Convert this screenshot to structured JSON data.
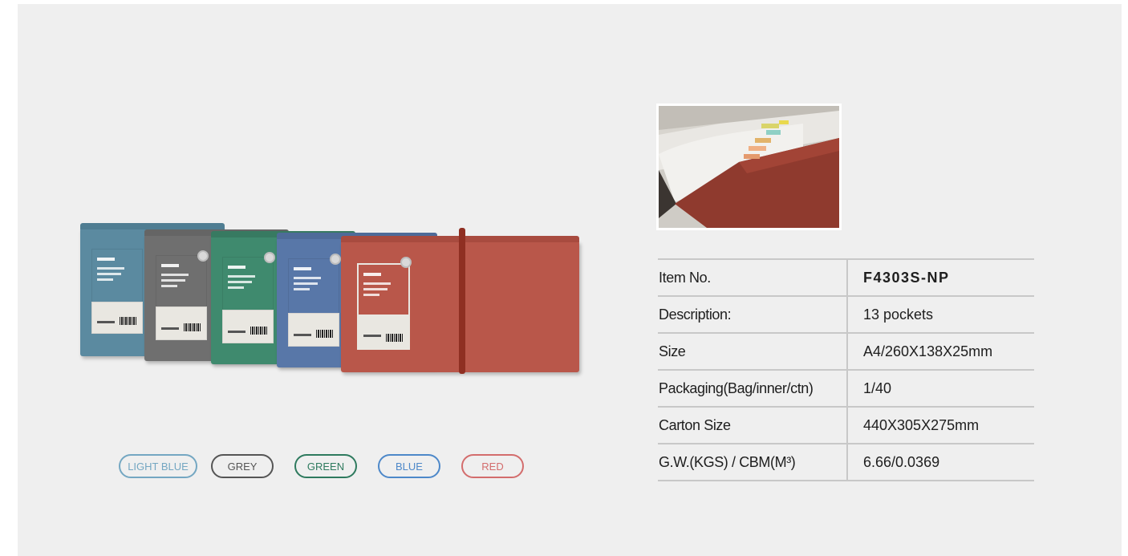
{
  "colors": {
    "panel": "#efefef",
    "light_blue": "#5b8aa0",
    "grey": "#6f6f6f",
    "green": "#3f8a6e",
    "blue": "#5877a8",
    "red": "#b9574a"
  },
  "product": {
    "card_text": {
      "title": "CHECK",
      "line1": "13POCKETS",
      "line2": "EXPANDING",
      "line3": "FILE"
    }
  },
  "color_options": [
    {
      "label": "LIGHT BLUE",
      "color": "#74a7c2"
    },
    {
      "label": "GREY",
      "color": "#555555"
    },
    {
      "label": "GREEN",
      "color": "#2e7a5e"
    },
    {
      "label": "BLUE",
      "color": "#4d88c9"
    },
    {
      "label": "RED",
      "color": "#d36d6d"
    }
  ],
  "specs": [
    {
      "key": "Item No.",
      "value": "F4303S-NP"
    },
    {
      "key": "Description:",
      "value": "13 pockets"
    },
    {
      "key": "Size",
      "value": "A4/260X138X25mm"
    },
    {
      "key": "Packaging(Bag/inner/ctn)",
      "value": "1/40"
    },
    {
      "key": "Carton Size",
      "value": "440X305X275mm"
    },
    {
      "key": "G.W.(KGS) / CBM(M³)",
      "value": "6.66/0.0369"
    }
  ]
}
